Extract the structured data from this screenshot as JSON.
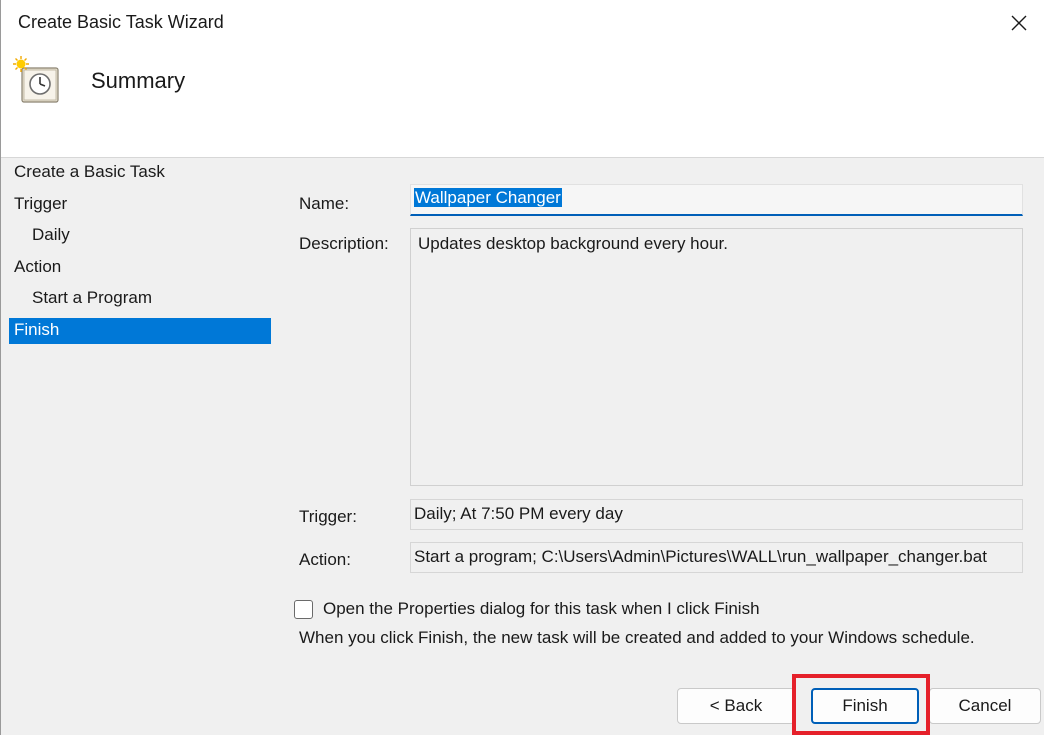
{
  "window": {
    "title": "Create Basic Task Wizard",
    "close_icon": "close-icon"
  },
  "header": {
    "icon": "task-scheduler-clock-icon",
    "title": "Summary"
  },
  "sidebar": {
    "items": [
      {
        "label": "Create a Basic Task",
        "level": 0,
        "active": false
      },
      {
        "label": "Trigger",
        "level": 0,
        "active": false
      },
      {
        "label": "Daily",
        "level": 1,
        "active": false
      },
      {
        "label": "Action",
        "level": 0,
        "active": false
      },
      {
        "label": "Start a Program",
        "level": 1,
        "active": false
      },
      {
        "label": "Finish",
        "level": 0,
        "active": true
      }
    ]
  },
  "summary": {
    "name_label": "Name:",
    "name_value": "Wallpaper Changer",
    "description_label": "Description:",
    "description_value": "Updates desktop background every hour.",
    "trigger_label": "Trigger:",
    "trigger_value": "Daily; At 7:50 PM every day",
    "action_label": "Action:",
    "action_value": "Start a program; C:\\Users\\Admin\\Pictures\\WALL\\run_wallpaper_changer.bat"
  },
  "options": {
    "open_properties_label": "Open the Properties dialog for this task when I click Finish",
    "open_properties_checked": false,
    "finish_note": "When you click Finish, the new task will be created and added to your Windows schedule."
  },
  "buttons": {
    "back_label": "< Back",
    "finish_label": "Finish",
    "cancel_label": "Cancel"
  },
  "colors": {
    "accent": "#0078d7",
    "highlight_box": "#e5202a"
  }
}
